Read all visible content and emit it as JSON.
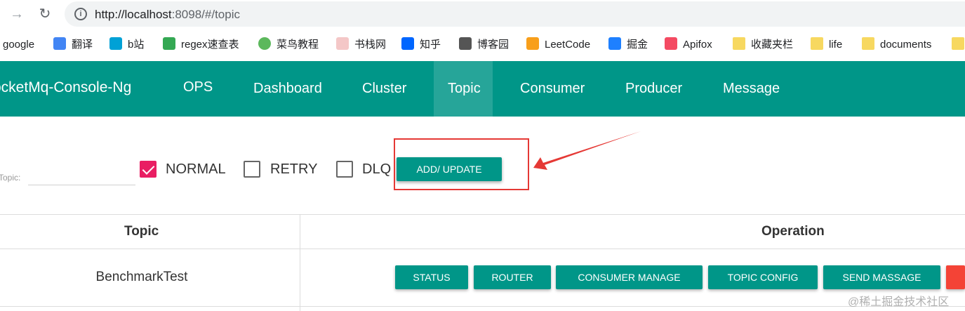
{
  "browser": {
    "url_host": "http://localhost",
    "url_rest": ":8098/#/topic"
  },
  "bookmarks": [
    {
      "label": "google",
      "icon": "google-icon",
      "color": "#ffffff"
    },
    {
      "label": "翻译",
      "icon": "translate-icon",
      "color": "#4285f4"
    },
    {
      "label": "b站",
      "icon": "bilibili-icon",
      "color": "#00a1d6"
    },
    {
      "label": "regex速查表",
      "icon": "lock-icon",
      "color": "#34a853"
    },
    {
      "label": "菜鸟教程",
      "icon": "runoob-icon",
      "color": "#5cb85c"
    },
    {
      "label": "书栈网",
      "icon": "bookstack-icon",
      "color": "#e06666"
    },
    {
      "label": "知乎",
      "icon": "zhihu-icon",
      "color": "#0066ff"
    },
    {
      "label": "博客园",
      "icon": "cnblogs-icon",
      "color": "#333333"
    },
    {
      "label": "LeetCode",
      "icon": "leetcode-icon",
      "color": "#f89f1b"
    },
    {
      "label": "掘金",
      "icon": "juejin-icon",
      "color": "#1e80ff"
    },
    {
      "label": "Apifox",
      "icon": "apifox-icon",
      "color": "#f44a62"
    },
    {
      "label": "收藏夹栏",
      "icon": "folder-icon",
      "color": "#f7d860"
    },
    {
      "label": "life",
      "icon": "folder-icon",
      "color": "#f7d860"
    },
    {
      "label": "documents",
      "icon": "folder-icon",
      "color": "#f7d860"
    }
  ],
  "header": {
    "brand": "ocketMq-Console-Ng",
    "nav": [
      "OPS",
      "Dashboard",
      "Cluster",
      "Topic",
      "Consumer",
      "Producer",
      "Message"
    ],
    "active": "Topic",
    "color": "#009688"
  },
  "filter": {
    "topic_label": "Topic:",
    "topic_value": "",
    "checkboxes": [
      {
        "label": "NORMAL",
        "checked": true
      },
      {
        "label": "RETRY",
        "checked": false
      },
      {
        "label": "DLQ",
        "checked": false
      }
    ],
    "add_update": "ADD/ UPDATE"
  },
  "table": {
    "headers": [
      "Topic",
      "Operation"
    ],
    "rows": [
      {
        "topic": "BenchmarkTest",
        "operations": [
          "STATUS",
          "ROUTER",
          "CONSUMER MANAGE",
          "TOPIC CONFIG",
          "SEND MASSAGE",
          ""
        ]
      }
    ]
  },
  "watermark": "@稀土掘金技术社区"
}
